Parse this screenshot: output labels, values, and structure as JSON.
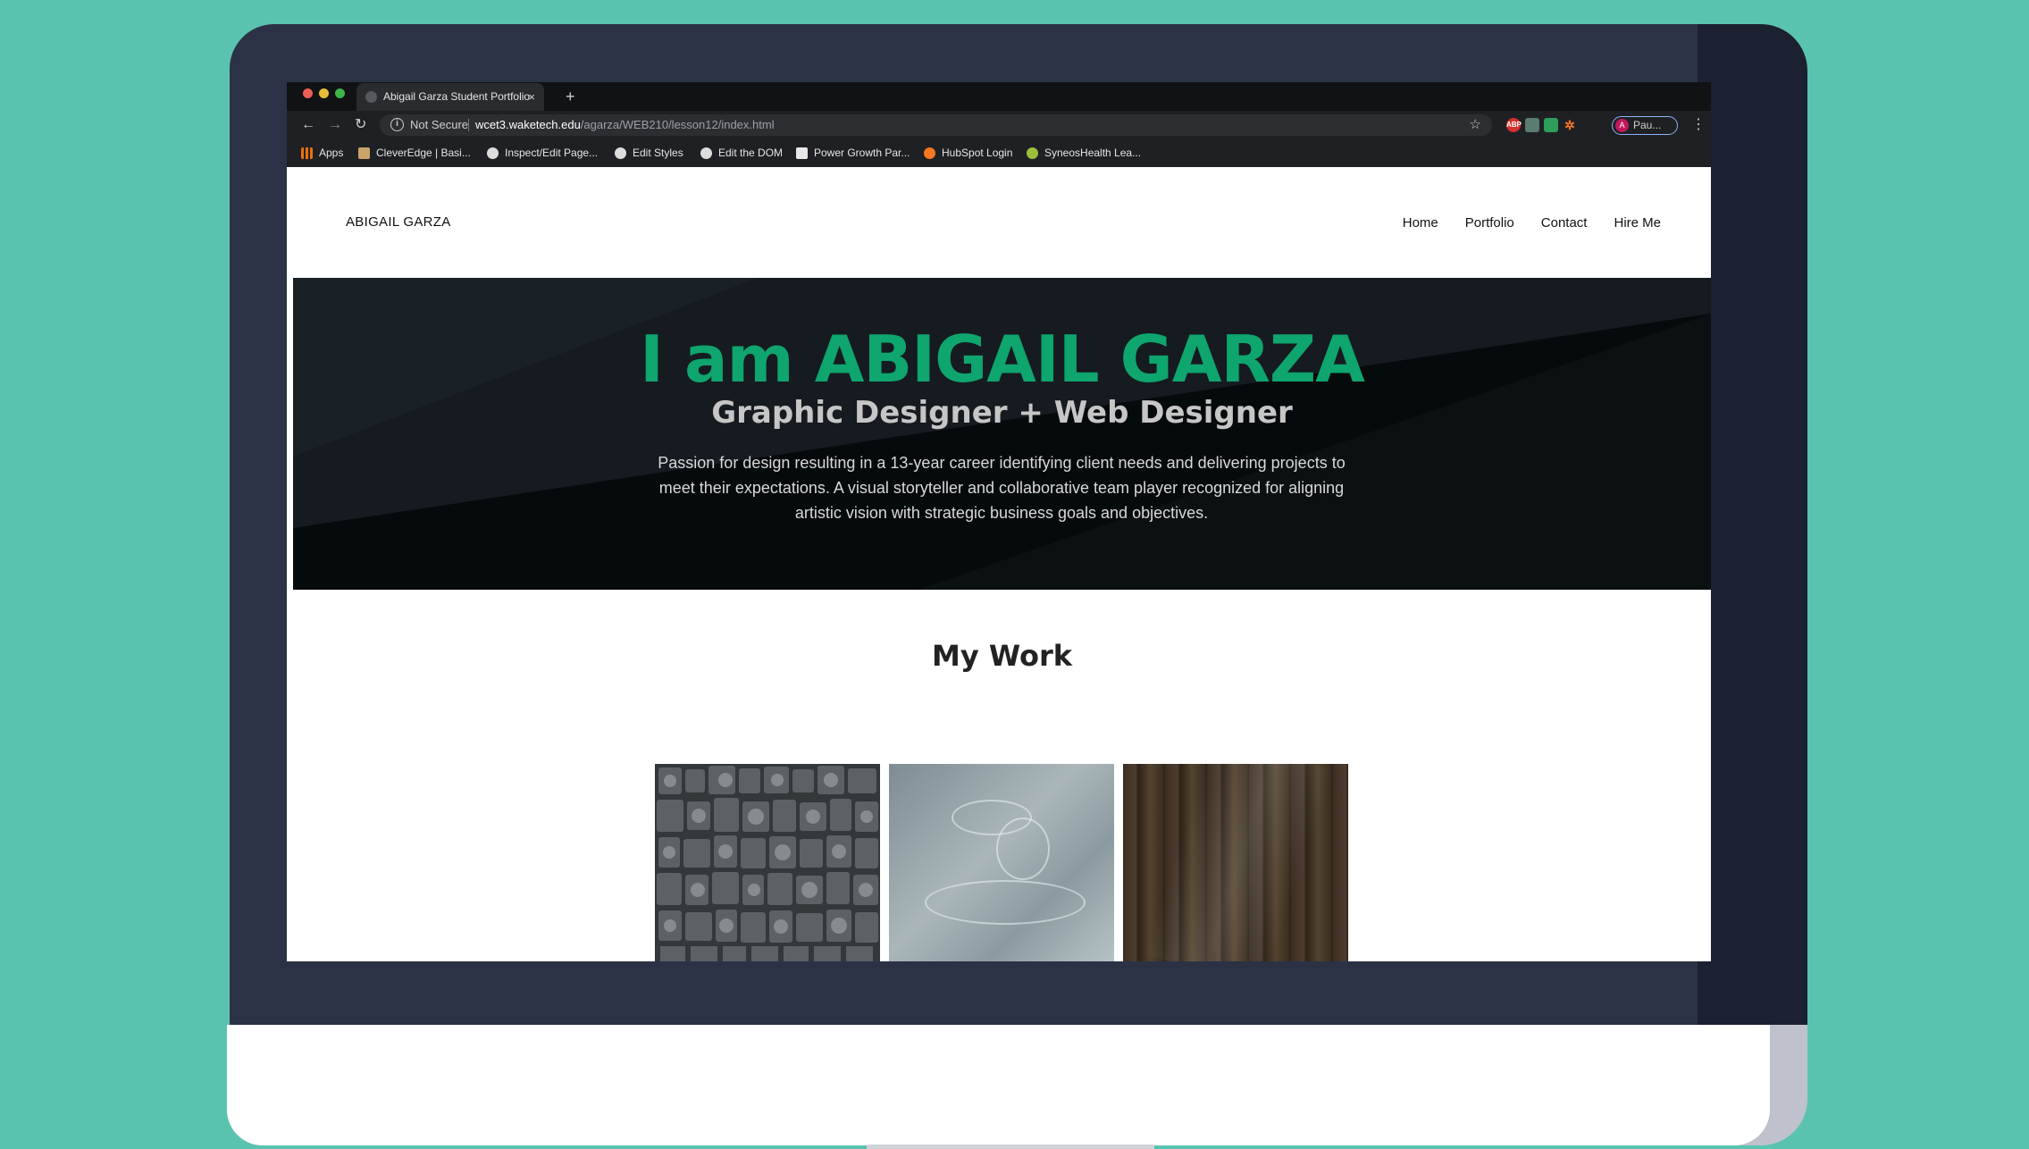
{
  "browser": {
    "tab_title": "Abigail Garza Student Portfolio",
    "tab_close": "×",
    "new_tab": "+",
    "nav": {
      "back": "←",
      "forward": "→",
      "reload": "↻"
    },
    "security_label": "Not Secure",
    "url_host": "wcet3.waketech.edu",
    "url_path": "/agarza/WEB210/lesson12/index.html",
    "bookmark_star": "☆",
    "extensions": [
      {
        "name": "adblock-extension-icon",
        "label": "ABP",
        "color": "#d3302f"
      },
      {
        "name": "extension-icon-2",
        "label": "",
        "color": "#5a7d70"
      },
      {
        "name": "extension-icon-3",
        "label": "",
        "color": "#2e9e5b"
      },
      {
        "name": "hubspot-extension-icon",
        "label": "",
        "color": "#f57722"
      }
    ],
    "profile_initial": "A",
    "profile_name": "Pau...",
    "menu": "⋮",
    "bookmarks": [
      {
        "label": "Apps",
        "icon": "apps-grid-icon",
        "color": "#e8710a"
      },
      {
        "label": "CleverEdge | Basi...",
        "icon": "cleveredge-icon",
        "color": "#c9a46b"
      },
      {
        "label": "Inspect/Edit Page...",
        "icon": "bookmarklet-icon",
        "color": "#dddddd"
      },
      {
        "label": "Edit Styles",
        "icon": "bookmarklet-icon",
        "color": "#dddddd"
      },
      {
        "label": "Edit the DOM",
        "icon": "bookmarklet-icon",
        "color": "#dddddd"
      },
      {
        "label": "Power Growth Par...",
        "icon": "power-growth-icon",
        "color": "#e8e8e8"
      },
      {
        "label": "HubSpot Login",
        "icon": "hubspot-icon",
        "color": "#f57722"
      },
      {
        "label": "SyneosHealth Lea...",
        "icon": "syneos-icon",
        "color": "#9bbf3b"
      }
    ]
  },
  "site": {
    "logo": "ABIGAIL GARZA",
    "nav": [
      "Home",
      "Portfolio",
      "Contact",
      "Hire Me"
    ],
    "hero": {
      "title": "I am ABIGAIL GARZA",
      "subtitle": "Graphic Designer + Web Designer",
      "description": "Passion for design resulting in a 13-year career identifying client needs and delivering projects to meet their expectations. A visual storyteller and collaborative team player recognized for aligning artistic vision with strategic business goals and objectives."
    },
    "work_title": "My Work",
    "colors": {
      "accent": "#0ea56e",
      "hero_bg": "#050a0c",
      "background": "#5ac3b0"
    }
  }
}
